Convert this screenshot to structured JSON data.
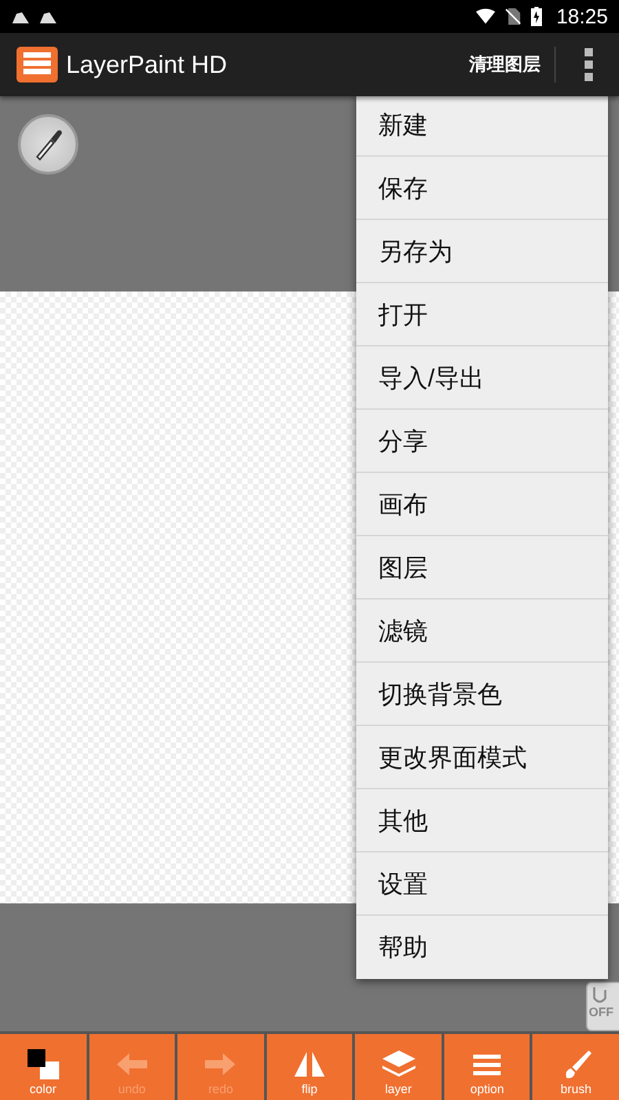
{
  "status_bar": {
    "time": "18:25"
  },
  "app_bar": {
    "title": "LayerPaint HD",
    "action": "清理图层"
  },
  "menu": {
    "items": [
      {
        "label": "新建"
      },
      {
        "label": "保存"
      },
      {
        "label": "另存为"
      },
      {
        "label": "打开"
      },
      {
        "label": "导入/导出"
      },
      {
        "label": "分享"
      },
      {
        "label": "画布"
      },
      {
        "label": "图层"
      },
      {
        "label": "滤镜"
      },
      {
        "label": "切换背景色"
      },
      {
        "label": "更改界面模式"
      },
      {
        "label": "其他"
      },
      {
        "label": "设置"
      },
      {
        "label": "帮助"
      }
    ]
  },
  "toggle": {
    "label": "OFF"
  },
  "toolbar": [
    {
      "kind": "color",
      "label": "color",
      "disabled": false
    },
    {
      "kind": "undo",
      "label": "undo",
      "disabled": true
    },
    {
      "kind": "redo",
      "label": "redo",
      "disabled": true
    },
    {
      "kind": "flip",
      "label": "flip",
      "disabled": false
    },
    {
      "kind": "layer",
      "label": "layer",
      "disabled": false
    },
    {
      "kind": "option",
      "label": "option",
      "disabled": false
    },
    {
      "kind": "brush",
      "label": "brush",
      "disabled": false
    }
  ]
}
